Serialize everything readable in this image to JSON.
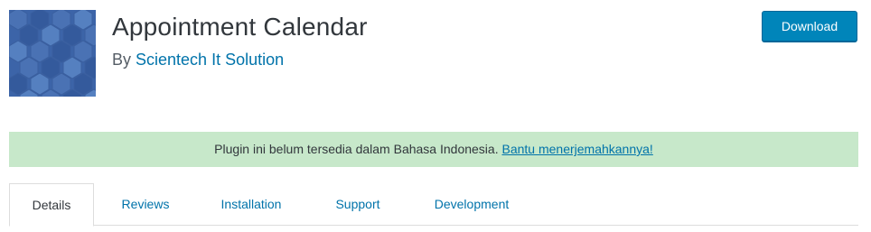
{
  "plugin": {
    "title": "Appointment Calendar",
    "author_prefix": "By ",
    "author_name": "Scientech It Solution",
    "icon": "hexagon-pattern-icon",
    "icon_colors": [
      "#3c64a8",
      "#4a72b4",
      "#345a9c",
      "#5580c0"
    ]
  },
  "actions": {
    "download_label": "Download"
  },
  "notice": {
    "text": "Plugin ini belum tersedia dalam Bahasa Indonesia. ",
    "link_text": "Bantu menerjemahkannya!",
    "background": "#c7e8ca"
  },
  "tabs": [
    {
      "label": "Details",
      "active": true
    },
    {
      "label": "Reviews",
      "active": false
    },
    {
      "label": "Installation",
      "active": false
    },
    {
      "label": "Support",
      "active": false
    },
    {
      "label": "Development",
      "active": false
    }
  ],
  "colors": {
    "accent": "#0085ba",
    "link": "#0073aa",
    "text": "#32373c"
  }
}
